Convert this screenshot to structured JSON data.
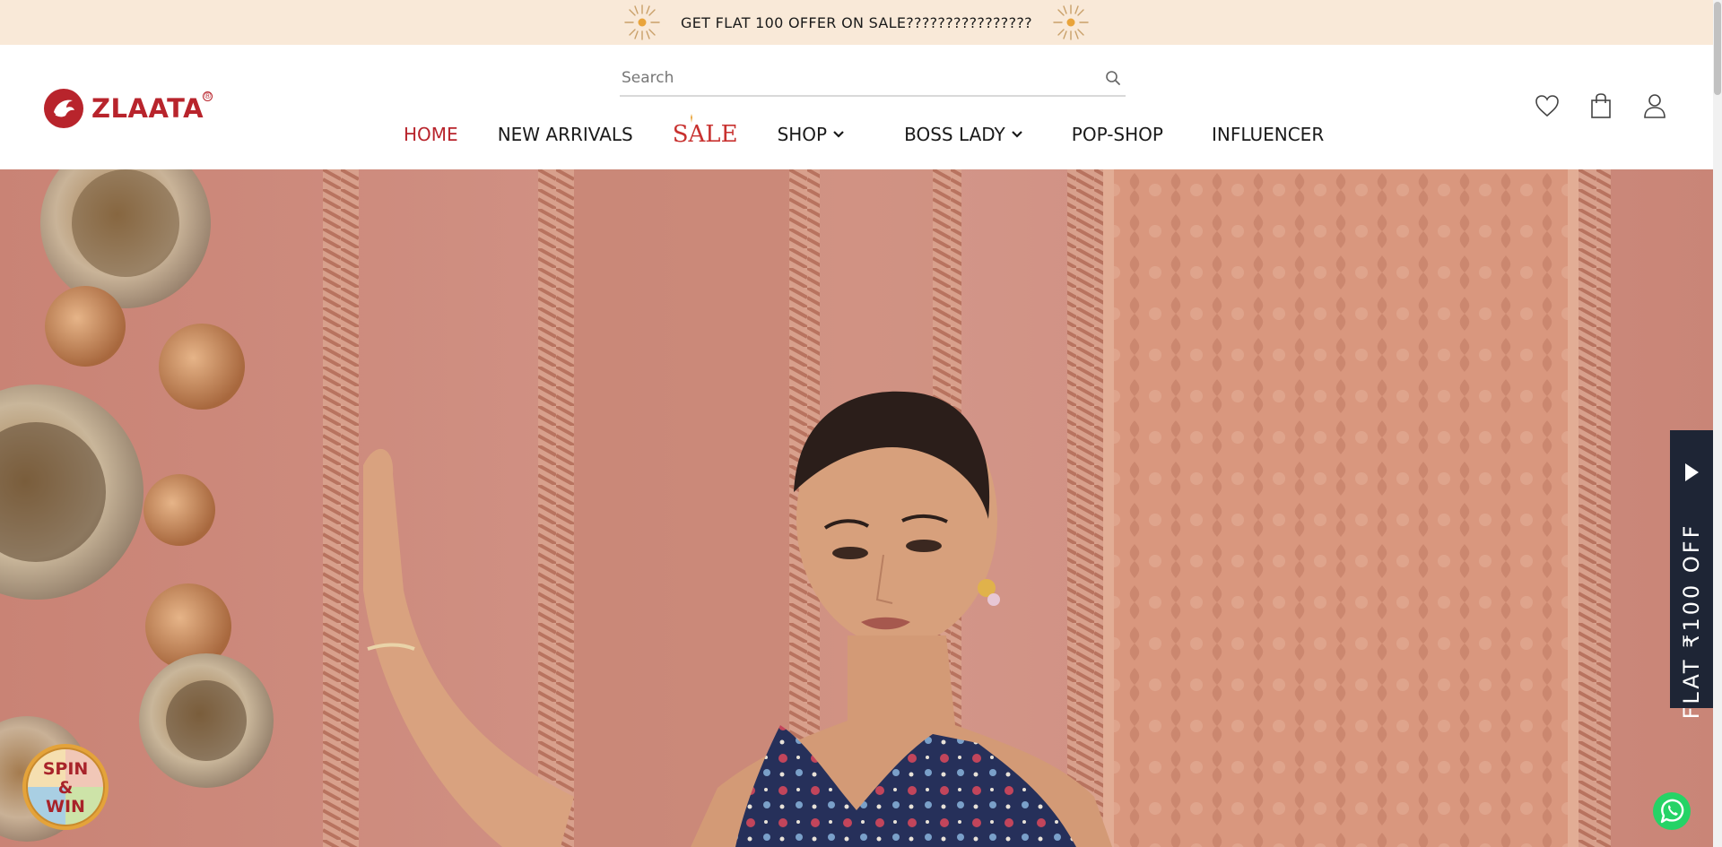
{
  "announcement": {
    "text": "GET FLAT 100 OFFER ON SALE????????????????",
    "icons": [
      "firework-icon",
      "firework-icon"
    ]
  },
  "header": {
    "logo_text": "ZLAATA",
    "logo_reg": "®",
    "search": {
      "placeholder": "Search",
      "value": ""
    },
    "nav": [
      {
        "label": "HOME",
        "active": true
      },
      {
        "label": "NEW ARRIVALS"
      },
      {
        "label": "SALE"
      },
      {
        "label": "SHOP",
        "has_dropdown": true
      },
      {
        "label": "BOSS LADY",
        "has_dropdown": true
      },
      {
        "label": "POP-SHOP"
      },
      {
        "label": "INFLUENCER"
      }
    ],
    "icons": [
      "wishlist-heart-icon",
      "shopping-bag-icon",
      "account-user-icon"
    ]
  },
  "side_tab": {
    "label": "FLAT ₹100 OFF"
  },
  "spin_widget": {
    "label_line1": "SPIN",
    "label_line2": "&",
    "label_line3": "WIN"
  },
  "floating_icons": [
    "whatsapp-icon"
  ],
  "colors": {
    "brand": "#b8242c",
    "announcement_bg": "#f9e9d8",
    "sale": "#c8312f",
    "side_tab_bg": "#1e2535",
    "whatsapp": "#25d366"
  }
}
